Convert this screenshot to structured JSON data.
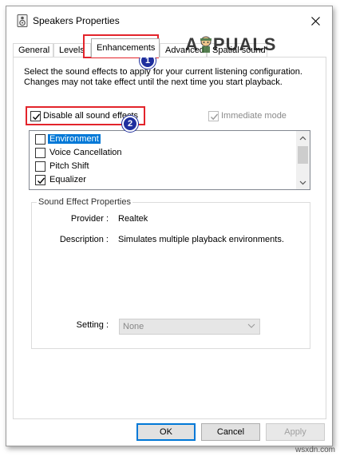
{
  "window": {
    "title": "Speakers Properties",
    "close_glyph": "✕"
  },
  "tabs": [
    {
      "label": "General"
    },
    {
      "label": "Levels"
    },
    {
      "label": "Enhancements",
      "active": true
    },
    {
      "label": "Advanced"
    },
    {
      "label": "Spatial sound"
    }
  ],
  "watermark": {
    "text_a": "A",
    "text_b": "PUALS"
  },
  "enhancements": {
    "description": "Select the sound effects to apply for your current listening configuration. Changes may not take effect until the next time you start playback.",
    "disable_all": {
      "label": "Disable all sound effects",
      "checked": true
    },
    "immediate_mode": {
      "label": "Immediate mode",
      "checked": true,
      "disabled": true
    },
    "effects": [
      {
        "label": "Environment",
        "checked": false,
        "selected": true
      },
      {
        "label": "Voice Cancellation",
        "checked": false
      },
      {
        "label": "Pitch Shift",
        "checked": false
      },
      {
        "label": "Equalizer",
        "checked": true
      }
    ],
    "properties": {
      "group_title": "Sound Effect Properties",
      "provider_label": "Provider :",
      "provider_value": "Realtek",
      "description_label": "Description :",
      "description_value": "Simulates multiple playback environments.",
      "setting_label": "Setting :",
      "setting_value": "None"
    }
  },
  "buttons": {
    "ok": "OK",
    "cancel": "Cancel",
    "apply": "Apply"
  },
  "annotations": {
    "badge1": "1",
    "badge2": "2",
    "color": "#e3242b",
    "badge_color": "#1f2f9e"
  },
  "site": "wsxdn.com",
  "colors": {
    "selection": "#0078d7",
    "accent": "#0078d7"
  }
}
